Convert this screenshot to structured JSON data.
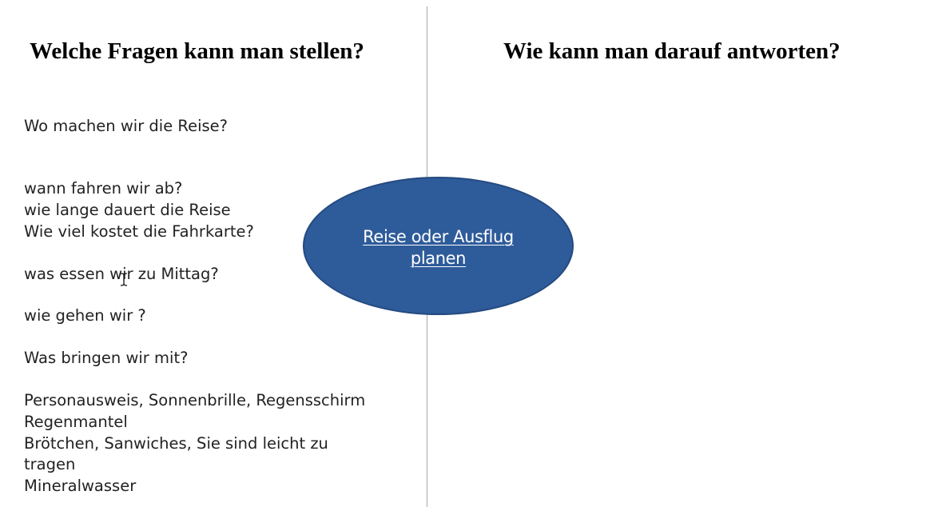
{
  "headings": {
    "left": "Welche Fragen kann man stellen?",
    "right": "Wie kann man darauf antworten?"
  },
  "questions": {
    "q1": "Wo machen wir die Reise?",
    "q2": "wann fahren wir ab?",
    "q3": "wie lange dauert die Reise",
    "q4": "Wie viel kostet die Fahrkarte?",
    "q5": "was essen wir zu Mittag?",
    "q6": "wie gehen wir ?",
    "q7": "Was bringen wir mit?"
  },
  "items": {
    "line1": "Personausweis, Sonnenbrille, Regensschirm",
    "line2": "Regenmantel",
    "line3": "Brötchen, Sanwiches, Sie sind  leicht zu",
    "line4": "tragen",
    "line5": "Mineralwasser"
  },
  "center": {
    "line1": "Reise oder Ausflug",
    "line2": "planen"
  },
  "colors": {
    "ellipse_fill": "#2e5b9a",
    "heading_text": "#000000",
    "divider": "#a6a6a6"
  },
  "icons": {
    "cursor": "text-cursor-icon"
  }
}
